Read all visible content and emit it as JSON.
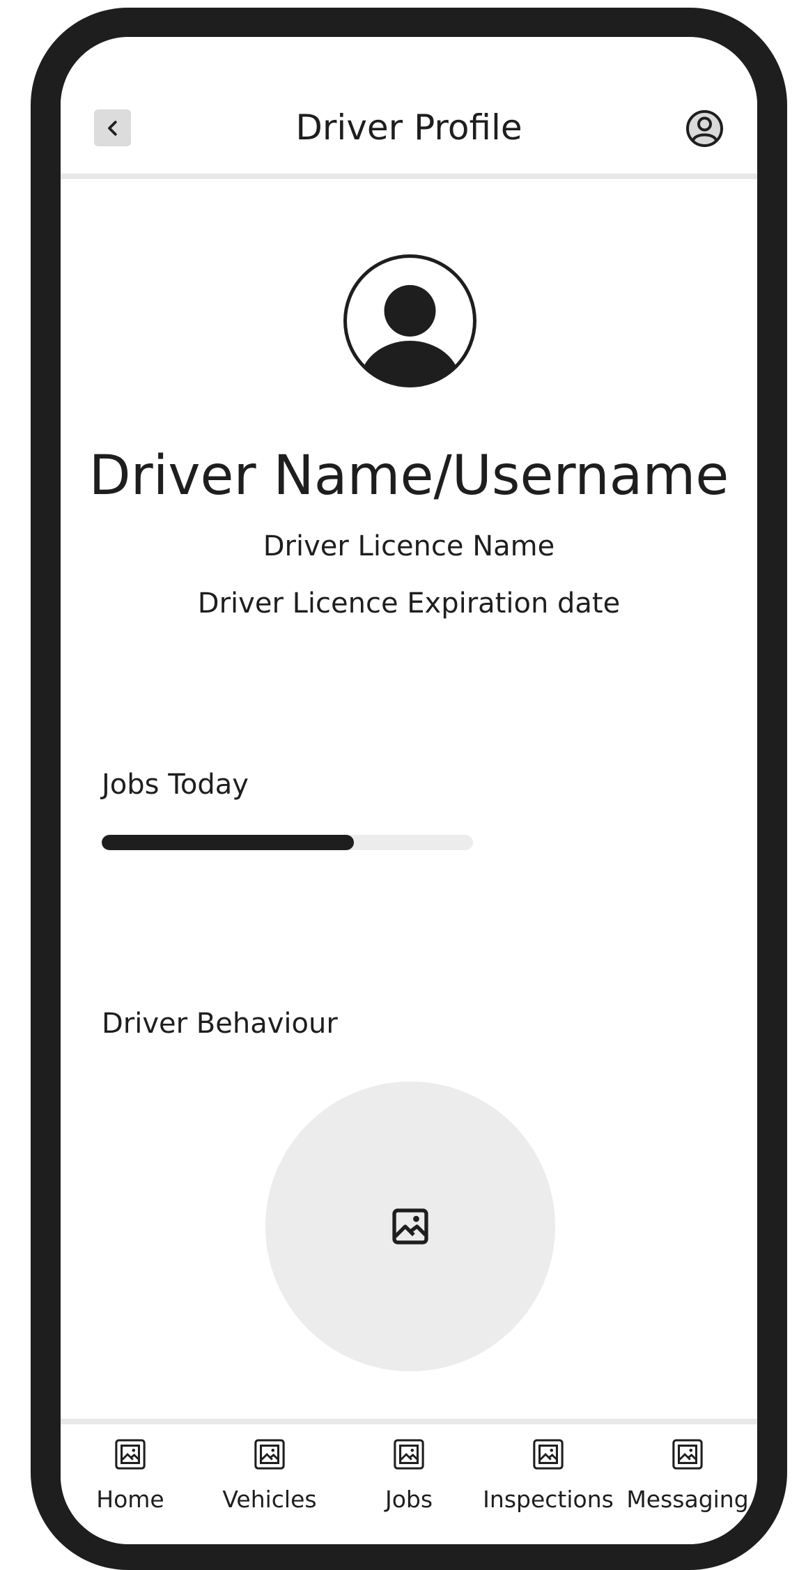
{
  "header": {
    "title": "Driver Profile",
    "back_icon": "chevron-left-icon",
    "profile_icon": "user-circle-icon"
  },
  "profile": {
    "avatar_icon": "user-avatar-icon",
    "name": "Driver Name/Username",
    "licence_name": "Driver Licence Name",
    "licence_expiration": "Driver Licence Expiration date"
  },
  "jobs": {
    "label": "Jobs Today",
    "progress": 0.68
  },
  "behaviour": {
    "label": "Driver Behaviour",
    "placeholder_icon": "image-icon"
  },
  "tabs": [
    {
      "label": "Home",
      "icon": "image-icon"
    },
    {
      "label": "Vehicles",
      "icon": "image-icon"
    },
    {
      "label": "Jobs",
      "icon": "image-icon"
    },
    {
      "label": "Inspections",
      "icon": "image-icon"
    },
    {
      "label": "Messaging",
      "icon": "image-icon"
    }
  ],
  "colors": {
    "frame": "#1e1e1e",
    "accent": "#1e1e1e",
    "muted": "#ececec"
  }
}
